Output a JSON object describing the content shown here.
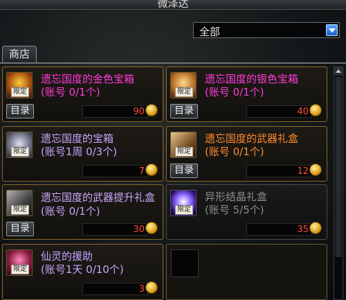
{
  "window": {
    "title": "微泽达"
  },
  "filter": {
    "selected": "全部"
  },
  "tabs": [
    {
      "label": "商店"
    }
  ],
  "items": [
    {
      "name": "遗忘国度的金色宝箱",
      "limit": "(账号 0/1个)",
      "price": "90",
      "catalog": "目录",
      "tag": "限定",
      "name_color": "pink"
    },
    {
      "name": "遗忘国度的银色宝箱",
      "limit": "(账号 0/1个)",
      "price": "40",
      "catalog": "目录",
      "tag": "限定",
      "name_color": "pink"
    },
    {
      "name": "遗忘国度的宝箱",
      "limit": "(账号1周 0/3个)",
      "price": "7",
      "catalog": "目录",
      "tag": "限定",
      "name_color": "purple"
    },
    {
      "name": "遗忘国度的武器礼盒",
      "limit": "(账号 0/1个)",
      "price": "12",
      "catalog": "目录",
      "tag": "限定",
      "name_color": "orange"
    },
    {
      "name": "遗忘国度的武器提升礼盒(账号 0/1个)",
      "limit": "",
      "price": "30",
      "catalog": "目录",
      "tag": "限定",
      "name_color": "purple"
    },
    {
      "name": "异形结晶礼盒",
      "limit": "(账号 5/5个)",
      "price": "35",
      "catalog": "",
      "tag": "限定",
      "name_color": "grey"
    },
    {
      "name": "仙灵的援助",
      "limit": "(账号1天 0/10个)",
      "price": "3",
      "catalog": "",
      "tag": "限定",
      "name_color": "purple"
    }
  ],
  "colors": {
    "pink": "#ff3ad8",
    "purple": "#c9a5ff",
    "orange": "#ff8a2a",
    "price": "#ff4a3a",
    "gold_border": "#8a6a2b"
  }
}
